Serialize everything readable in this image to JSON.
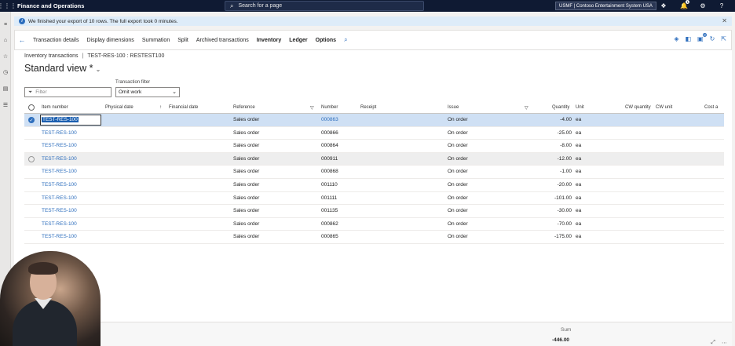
{
  "appbar": {
    "title": "Finance and Operations",
    "search_placeholder": "Search for a page",
    "company": "USMF | Contoso Entertainment System USA",
    "notification_count": "1"
  },
  "message": {
    "text": "We finished your export of 10 rows. The full export took 0 minutes."
  },
  "actions": {
    "items": [
      "Transaction details",
      "Display dimensions",
      "Summation",
      "Split",
      "Archived transactions",
      "Inventory",
      "Ledger",
      "Options"
    ],
    "bold_indices": [
      5,
      6,
      7
    ],
    "notification_count": "0"
  },
  "breadcrumb": {
    "page": "Inventory transactions",
    "record": "TEST-RES-100 : RESTEST100"
  },
  "view": {
    "title": "Standard view *"
  },
  "filter": {
    "placeholder": "Filter",
    "tx_label": "Transaction filter",
    "tx_value": "Omit work"
  },
  "grid": {
    "columns": {
      "item_number": "Item number",
      "physical_date": "Physical date",
      "financial_date": "Financial date",
      "reference": "Reference",
      "number": "Number",
      "receipt": "Receipt",
      "issue": "Issue",
      "quantity": "Quantity",
      "unit": "Unit",
      "cw_quantity": "CW quantity",
      "cw_unit": "CW unit",
      "cost_amount": "Cost a"
    },
    "rows": [
      {
        "item": "TEST-RES-100",
        "reference": "Sales order",
        "number": "000863",
        "issue": "On order",
        "quantity": "-4.00",
        "unit": "ea",
        "state": "selected"
      },
      {
        "item": "TEST-RES-100",
        "reference": "Sales order",
        "number": "000866",
        "issue": "On order",
        "quantity": "-25.00",
        "unit": "ea",
        "state": ""
      },
      {
        "item": "TEST-RES-100",
        "reference": "Sales order",
        "number": "000864",
        "issue": "On order",
        "quantity": "-8.00",
        "unit": "ea",
        "state": ""
      },
      {
        "item": "TEST-RES-100",
        "reference": "Sales order",
        "number": "000911",
        "issue": "On order",
        "quantity": "-12.00",
        "unit": "ea",
        "state": "hover"
      },
      {
        "item": "TEST-RES-100",
        "reference": "Sales order",
        "number": "000868",
        "issue": "On order",
        "quantity": "-1.00",
        "unit": "ea",
        "state": ""
      },
      {
        "item": "TEST-RES-100",
        "reference": "Sales order",
        "number": "001110",
        "issue": "On order",
        "quantity": "-20.00",
        "unit": "ea",
        "state": ""
      },
      {
        "item": "TEST-RES-100",
        "reference": "Sales order",
        "number": "001111",
        "issue": "On order",
        "quantity": "-101.00",
        "unit": "ea",
        "state": ""
      },
      {
        "item": "TEST-RES-100",
        "reference": "Sales order",
        "number": "001135",
        "issue": "On order",
        "quantity": "-30.00",
        "unit": "ea",
        "state": ""
      },
      {
        "item": "TEST-RES-100",
        "reference": "Sales order",
        "number": "000862",
        "issue": "On order",
        "quantity": "-70.00",
        "unit": "ea",
        "state": ""
      },
      {
        "item": "TEST-RES-100",
        "reference": "Sales order",
        "number": "000865",
        "issue": "On order",
        "quantity": "-175.00",
        "unit": "ea",
        "state": ""
      }
    ]
  },
  "footer": {
    "sum_label": "Sum",
    "sum_value": "-446.00"
  },
  "icons": {
    "waffle": "waffle-icon",
    "search": "search-icon",
    "copilot": "copilot-icon",
    "bell": "bell-icon",
    "gear": "gear-icon",
    "help": "help-icon",
    "back": "back-arrow-icon",
    "close": "close-icon"
  },
  "colors": {
    "appbar": "#0f1a33",
    "accent": "#2d6ebd",
    "selected_row": "#cfe0f4",
    "message_bar": "#deecf9"
  }
}
